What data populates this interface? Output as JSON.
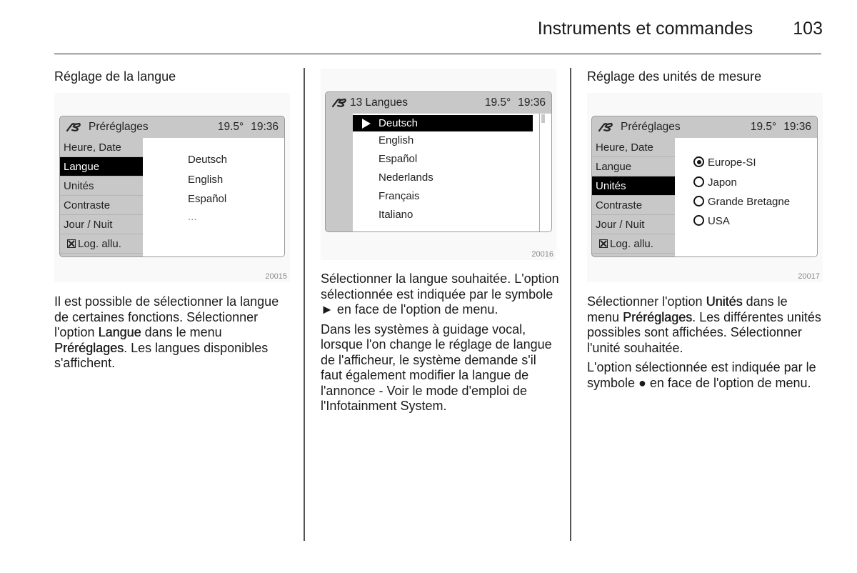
{
  "header": {
    "section": "Instruments et commandes",
    "page_number": "103"
  },
  "columns": [
    {
      "title": "Réglage de la langue",
      "figure": {
        "id": "20015",
        "screen": {
          "icon": "settings-wrench-icon",
          "title": "Préréglages",
          "temperature": "19.5°",
          "time": "19:36",
          "menu": [
            "Heure, Date",
            "Langue",
            "Unités",
            "Contraste",
            "Jour / Nuit",
            "Log. allu."
          ],
          "selected_index": 1,
          "options": [
            "Deutsch",
            "English",
            "Español",
            "..."
          ]
        }
      },
      "paragraphs": [
        [
          {
            "t": "Il est possible de sélectionner la langue de certaines fonctions. Sélectionner l'option "
          },
          {
            "t": "Langue",
            "b": true
          },
          {
            "t": " dans le menu "
          },
          {
            "t": "Préréglages",
            "b": true
          },
          {
            "t": ". Les langues disponibles s'affichent."
          }
        ]
      ]
    },
    {
      "title": "",
      "figure": {
        "id": "20016",
        "screen": {
          "icon": "settings-wrench-icon",
          "title": "13 Langues",
          "temperature": "19.5°",
          "time": "19:36",
          "languages": [
            "Deutsch",
            "English",
            "Español",
            "Nederlands",
            "Français",
            "Italiano"
          ],
          "selected_index": 0
        }
      },
      "paragraphs": [
        [
          {
            "t": "Sélectionner la langue souhaitée. L'option sélectionnée est indiquée par le symbole ► en face de l'option de menu."
          }
        ],
        [
          {
            "t": "Dans les systèmes à guidage vocal, lorsque l'on change le réglage de langue de l'afficheur, le système demande s'il faut également modifier la langue de l'annonce - Voir le mode d'emploi de l'Infotainment System."
          }
        ]
      ]
    },
    {
      "title": "Réglage des unités de mesure",
      "figure": {
        "id": "20017",
        "screen": {
          "icon": "settings-wrench-icon",
          "title": "Préréglages",
          "temperature": "19.5°",
          "time": "19:36",
          "menu": [
            "Heure, Date",
            "Langue",
            "Unités",
            "Contraste",
            "Jour / Nuit",
            "Log. allu."
          ],
          "selected_index": 2,
          "units": [
            "Europe-SI",
            "Japon",
            "Grande Bretagne",
            "USA"
          ],
          "selected_unit_index": 0
        }
      },
      "paragraphs": [
        [
          {
            "t": "Sélectionner l'option "
          },
          {
            "t": "Unités",
            "b": true
          },
          {
            "t": " dans le menu "
          },
          {
            "t": "Préréglages",
            "b": true
          },
          {
            "t": ". Les différentes unités possibles sont affichées. Sélectionner l'unité souhaitée."
          }
        ],
        [
          {
            "t": "L'option sélectionnée est indiquée par le symbole ● en face de l'option de menu."
          }
        ]
      ]
    }
  ]
}
